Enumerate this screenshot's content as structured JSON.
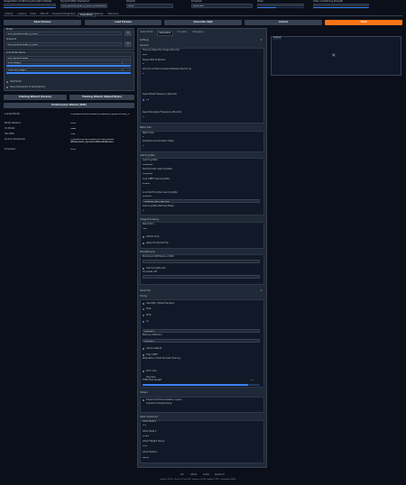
{
  "top_controls": [
    {
      "label": "Image/Video conditioning strength multiplier",
      "value": "0"
    },
    {
      "label": "DynamiCrafter Checkpoint",
      "value": "sdv_dynamicrafter_xl_1024_fp16.safetensors [...]"
    },
    {
      "label": "Sampler",
      "value": "None"
    },
    {
      "label": "Scheduler",
      "value": "Automatic"
    },
    {
      "label": "Steps",
      "value": "20"
    },
    {
      "label": "Video conditioning strength",
      "value": "0"
    }
  ],
  "main_tabs": [
    "txt2img",
    "img2img",
    "Extras",
    "PNG Info",
    "Checkpoint Merger",
    "Train",
    "DreamBooth",
    "Settings",
    "Extensions"
  ],
  "action_buttons": [
    "Save Params",
    "Load Params",
    "Generate Ckpt",
    "Cancel",
    "Train"
  ],
  "left": {
    "model_label": "Model",
    "model_value": "sdv_dynamicrafter_xl_1024",
    "snapshot_label": "Snapshot",
    "snapshot_value": "sdv_dynamicrafter_xl_1024",
    "lora_section_label": "Lora Model Name",
    "lora_rows": [
      "sdv_dynamicrafter",
      "Lora Weight",
      "Lora Text Weight"
    ],
    "lora_values": [
      "",
      "1",
      "1"
    ],
    "half_model_label": "Half Model",
    "save_checkpoint_label": "Save Checkpoint to Subdirectory",
    "btn_train_wizard_person": "Training Wizard (Person)",
    "btn_train_wizard_object": "Training Wizard (Object/Style)",
    "btn_performance_wizard": "Performance Wizard (WIP)",
    "info_rows": [
      {
        "label": "Loaded Model:",
        "value": "C:\\stable-diffusion-webui\\models\\sdv_dynamicrafter_xl"
      },
      {
        "label": "Model Revision:",
        "value": "3000"
      },
      {
        "label": "V2 Model:",
        "value": "False"
      },
      {
        "label": "Has EMA:",
        "value": "True"
      },
      {
        "label": "Source Checkpoint:",
        "value": "C:\\stable-diffusion-webui\\models\\Stable-diffusion\\sdv_dynamicrafter.safetensors"
      },
      {
        "label": "Scheduler:",
        "value": "ddim"
      }
    ]
  },
  "middle": {
    "sub_tabs": [
      "Select Model",
      "Parameters",
      "Concepts",
      "Debugging"
    ],
    "settings_label": "Settings",
    "general_label": "General",
    "train_steps_label": "Training Steps Per Image (Epochs)",
    "train_steps_value": "100",
    "pause_label": "Pause After N Epochs",
    "pause_value": "0",
    "amount_pause_label": "Amount of time to pause between Epochs (s)",
    "amount_pause_value": "0",
    "save_weights_label": "Save Model Frequency (Epochs)",
    "save_weights_value": "25",
    "save_preview_label": "Save Preview(s) Frequency (Epochs)",
    "save_preview_value": "5",
    "batching_label": "Batch Size",
    "batch_size_label": "Batch Size",
    "batch_size_value": "1",
    "grad_acc_label": "Gradient Accumulation Steps",
    "grad_acc_value": "1",
    "learning_rate_label": "Learning Rate",
    "lr_label": "Learning Rate",
    "lr_value": "0.000002",
    "lr_text_label": "Text Encoder Learning Rate",
    "lr_text_value": "0.000001",
    "lora_unet_label": "Lora UNET Learning Rate",
    "lora_unet_value": "0.0001",
    "lora_text_label": "Lora Text Encoder Learning Rate",
    "lora_text_value": "0.00005",
    "scheduler_label": "Learning Rate Scheduler",
    "scheduler_value": "constant_with_warmup",
    "warmup_label": "Learning Rate Warmup Steps",
    "warmup_value": "0",
    "image_proc_label": "Image Processing",
    "resolution_label": "Resolution",
    "resolution_value": "512",
    "center_crop_label": "Center Crop",
    "horizontal_flip_label": "Apply Horizontal Flip",
    "misc_label": "Miscellaneous",
    "pretrained_vae_label": "Pretrained VAE Name or Path",
    "pretrained_vae_value": "",
    "use_concepts_label": "Use Concepts List",
    "concepts_path_label": "Concepts List",
    "concepts_path_value": "",
    "advanced_label": "Advanced",
    "tuning_label": "Tuning",
    "mixed_precision_label": "Use EMA / Mixed Precision",
    "mp_options": [
      "fp16",
      "bf16",
      "no"
    ],
    "memory_attention_label": "Memory Attention",
    "memory_attention_value": "xformers",
    "cache_latents_label": "Cache Latents",
    "train_unet_label": "Train UNET",
    "step_ratio_label": "Step Ratio of Text Encoder Training",
    "step_ratio_value": "0",
    "offset_noise_label": "Offset Noise",
    "offset_noise_value": "0",
    "freeze_clip_label": "Freeze CLIP Normalization Layers",
    "clip_skip_label": "Clip Skip",
    "clip_skip_value": "1",
    "weight_decay_label": "Weight Decay",
    "weight_decay_value": "0.01",
    "tenc_label": "TENC Max Length",
    "tenc_value": "75",
    "prior_label": "Prior Loss",
    "gradient_checkpoint_label": "Gradient Checkpointing",
    "hidden_label": "Hidden",
    "sanity_label": "Sanity Sample Prompt",
    "sanity_value": "",
    "sanity_seed_label": "Sanity Sample Seed",
    "sanity_seed_value": "420420",
    "adam_label": "Adam Advanced",
    "adam_rows": [
      {
        "label": "Adam Beta 1",
        "value": "0.9"
      },
      {
        "label": "Adam Beta 2",
        "value": "0.999"
      },
      {
        "label": "Adam Weight Decay",
        "value": "0.01"
      },
      {
        "label": "Adam Epsilon",
        "value": "1e-08"
      }
    ]
  },
  "right": {
    "output_label": "Output",
    "placeholder_icon": "image-icon"
  },
  "footer": {
    "links": [
      "API",
      "Github",
      "Gradio",
      "Reload UI"
    ],
    "version": "python: 3.10.6  •  torch: 2.0.1+cu118  •  xformers: 0.0.20  •  gradio: 3.32.0  •  checkpoint: 3d08..."
  },
  "colors": {
    "background": "#0b0f19",
    "panel": "#1f2937",
    "accent": "#3b82f6",
    "train_button": "#f97316"
  }
}
